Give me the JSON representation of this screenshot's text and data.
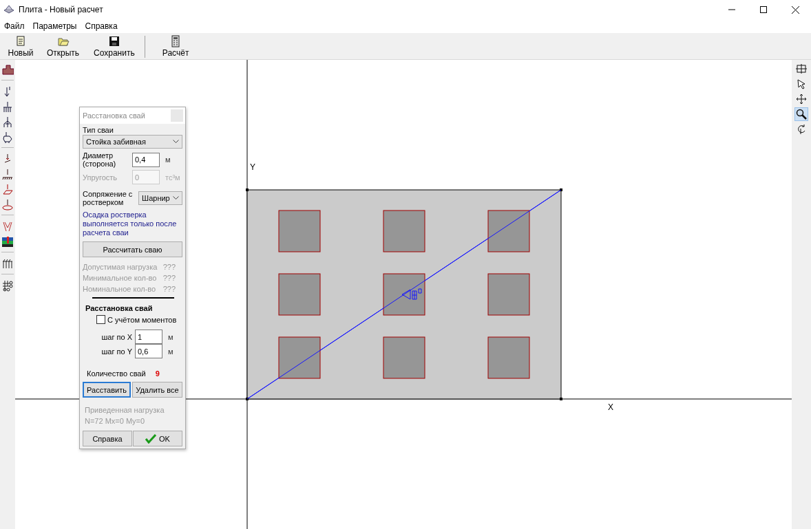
{
  "window": {
    "title": "Плита - Новый расчет"
  },
  "menu": [
    "Файл",
    "Параметры",
    "Справка"
  ],
  "toolbar": [
    {
      "label": "Новый",
      "kind": "new"
    },
    {
      "label": "Открыть",
      "kind": "open"
    },
    {
      "label": "Сохранить",
      "kind": "save"
    },
    {
      "label": "Расчёт",
      "kind": "calc",
      "separated": true
    }
  ],
  "left_tools": [
    {
      "kind": "plate"
    },
    {
      "kind": "force",
      "separated": true
    },
    {
      "kind": "force-piles"
    },
    {
      "kind": "force-bush"
    },
    {
      "kind": "force-spread"
    },
    {
      "kind": "pressure-point",
      "separated": true
    },
    {
      "kind": "pressure-line"
    },
    {
      "kind": "pressure-area"
    },
    {
      "kind": "pressure-ellipse"
    },
    {
      "kind": "settlement",
      "separated": true
    },
    {
      "kind": "soil"
    },
    {
      "kind": "piles",
      "separated": true
    },
    {
      "kind": "pile-grid",
      "separated": true
    }
  ],
  "right_tools": [
    {
      "kind": "grid",
      "selected": false
    },
    {
      "kind": "pointer",
      "selected": false
    },
    {
      "kind": "move",
      "selected": false
    },
    {
      "kind": "zoom",
      "selected": true
    },
    {
      "kind": "rotate",
      "selected": false
    }
  ],
  "canvas": {
    "y_label": "Y",
    "x_label": "X"
  },
  "dialog": {
    "title": "Расстановка свай",
    "pile_type": {
      "label": "Тип сваи",
      "value": "Стойка забивная"
    },
    "diameter": {
      "label": "Диаметр (сторона)",
      "value": "0,4",
      "unit": "м"
    },
    "elasticity": {
      "label": "Упругость",
      "value": "0",
      "unit": "тс³м",
      "disabled": true
    },
    "joint": {
      "label": "Сопряжение с ростверком",
      "value": "Шарнир"
    },
    "note": "Осадка ростверка выполняется только после расчета сваи",
    "calc_button": "Рассчитать сваю",
    "results": [
      {
        "label": "Допустимая нагрузка",
        "value": "???"
      },
      {
        "label": "Минимальное кол-во",
        "value": "???"
      },
      {
        "label": "Номинальное кол-во",
        "value": "???"
      }
    ],
    "layout_title": "Расстановка свай",
    "moments": {
      "label": "С учётом моментов",
      "checked": false
    },
    "steps": [
      {
        "label": "шаг по X",
        "value": "1",
        "unit": "м"
      },
      {
        "label": "шаг по Y",
        "value": "0,6",
        "unit": "м"
      }
    ],
    "count": {
      "label": "Количество свай",
      "value": "9"
    },
    "place_button": "Расставить",
    "delete_button": "Удалить все",
    "reduced_load": {
      "label": "Приведенная нагрузка",
      "value": "N=72  Mx=0  My=0"
    },
    "help_button": "Справка",
    "ok_button": "OK"
  }
}
